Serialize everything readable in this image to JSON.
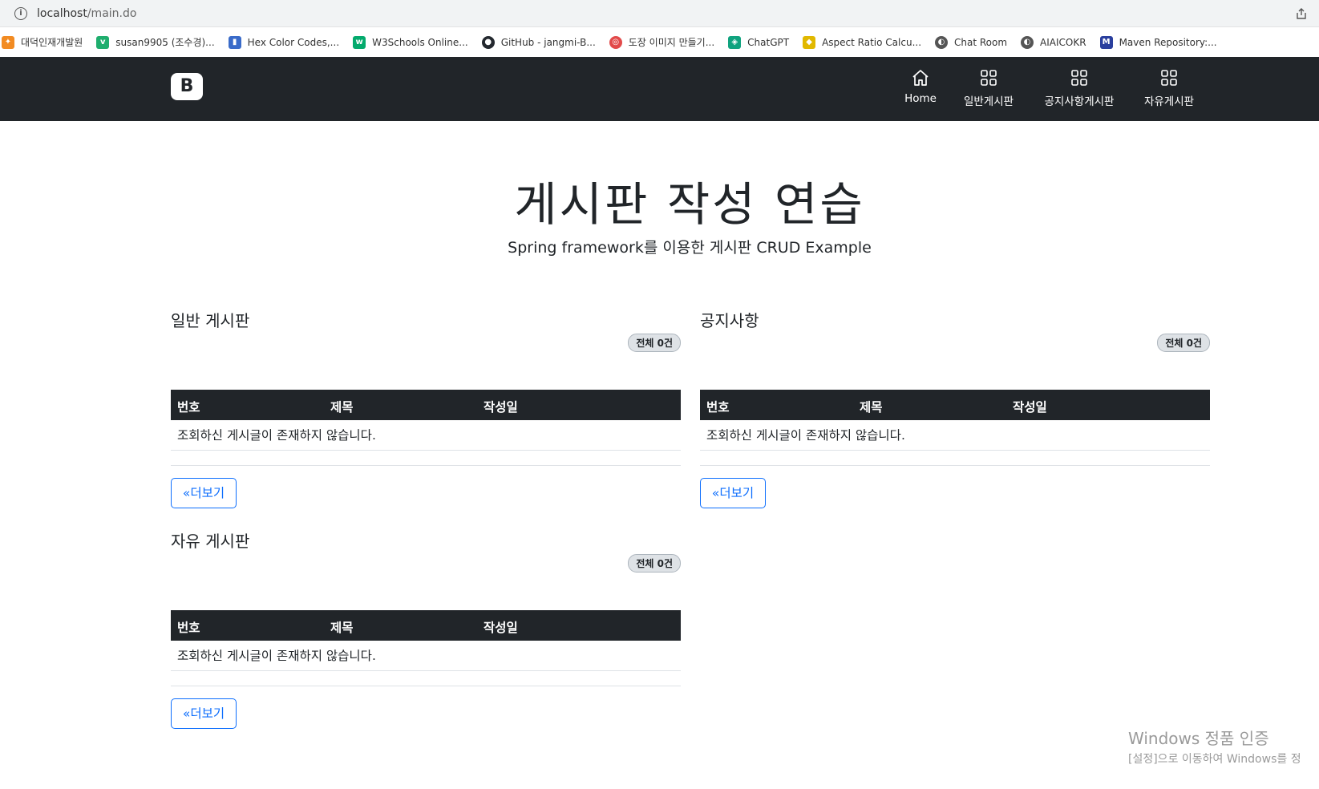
{
  "browser": {
    "url_host": "localhost",
    "url_path": "/main.do",
    "bookmarks": [
      {
        "label": "대덕인재개발원",
        "color": "#f28b22",
        "glyph": "✦"
      },
      {
        "label": "susan9905 (조수경)...",
        "color": "#1fae6e",
        "glyph": "v"
      },
      {
        "label": "Hex Color Codes,...",
        "color": "#3a6bc9",
        "glyph": "▮"
      },
      {
        "label": "W3Schools Online...",
        "color": "#04aa6d",
        "glyph": "w"
      },
      {
        "label": "GitHub - jangmi-B...",
        "color": "#24292f",
        "glyph": "●"
      },
      {
        "label": "도장 이미지 만들기...",
        "color": "#e24a4a",
        "glyph": "◎"
      },
      {
        "label": "ChatGPT",
        "color": "#10a37f",
        "glyph": "◈"
      },
      {
        "label": "Aspect Ratio Calcu...",
        "color": "#e1b800",
        "glyph": "◆"
      },
      {
        "label": "Chat Room",
        "color": "#555555",
        "glyph": "◐"
      },
      {
        "label": "AIAICOKR",
        "color": "#555555",
        "glyph": "◐"
      },
      {
        "label": "Maven Repository:...",
        "color": "#2a3f9e",
        "glyph": "M"
      }
    ]
  },
  "navbar": {
    "brand": "B",
    "items": [
      {
        "label": "Home",
        "icon": "home-icon"
      },
      {
        "label": "일반게시판",
        "icon": "grid-icon"
      },
      {
        "label": "공지사항게시판",
        "icon": "grid-icon"
      },
      {
        "label": "자유게시판",
        "icon": "grid-icon"
      }
    ]
  },
  "hero": {
    "title": "게시판 작성 연습",
    "subtitle": "Spring framework를 이용한 게시판 CRUD Example"
  },
  "boards": {
    "general": {
      "title": "일반 게시판",
      "badge": "전체 0건",
      "columns": [
        "번호",
        "제목",
        "작성일"
      ],
      "empty_message": "조회하신 게시글이 존재하지 않습니다.",
      "more": "«더보기"
    },
    "notice": {
      "title": "공지사항",
      "badge": "전체 0건",
      "columns": [
        "번호",
        "제목",
        "작성일"
      ],
      "empty_message": "조회하신 게시글이 존재하지 않습니다.",
      "more": "«더보기"
    },
    "free": {
      "title": "자유 게시판",
      "badge": "전체 0건",
      "columns": [
        "번호",
        "제목",
        "작성일"
      ],
      "empty_message": "조회하신 게시글이 존재하지 않습니다.",
      "more": "«더보기"
    }
  },
  "watermark": {
    "line1": "Windows 정품 인증",
    "line2": "[설정]으로 이동하여 Windows를 정"
  },
  "colors": {
    "navbar_bg": "#212529",
    "table_head_bg": "#212529",
    "button_accent": "#0d6efd",
    "badge_bg": "#dee2e6"
  }
}
